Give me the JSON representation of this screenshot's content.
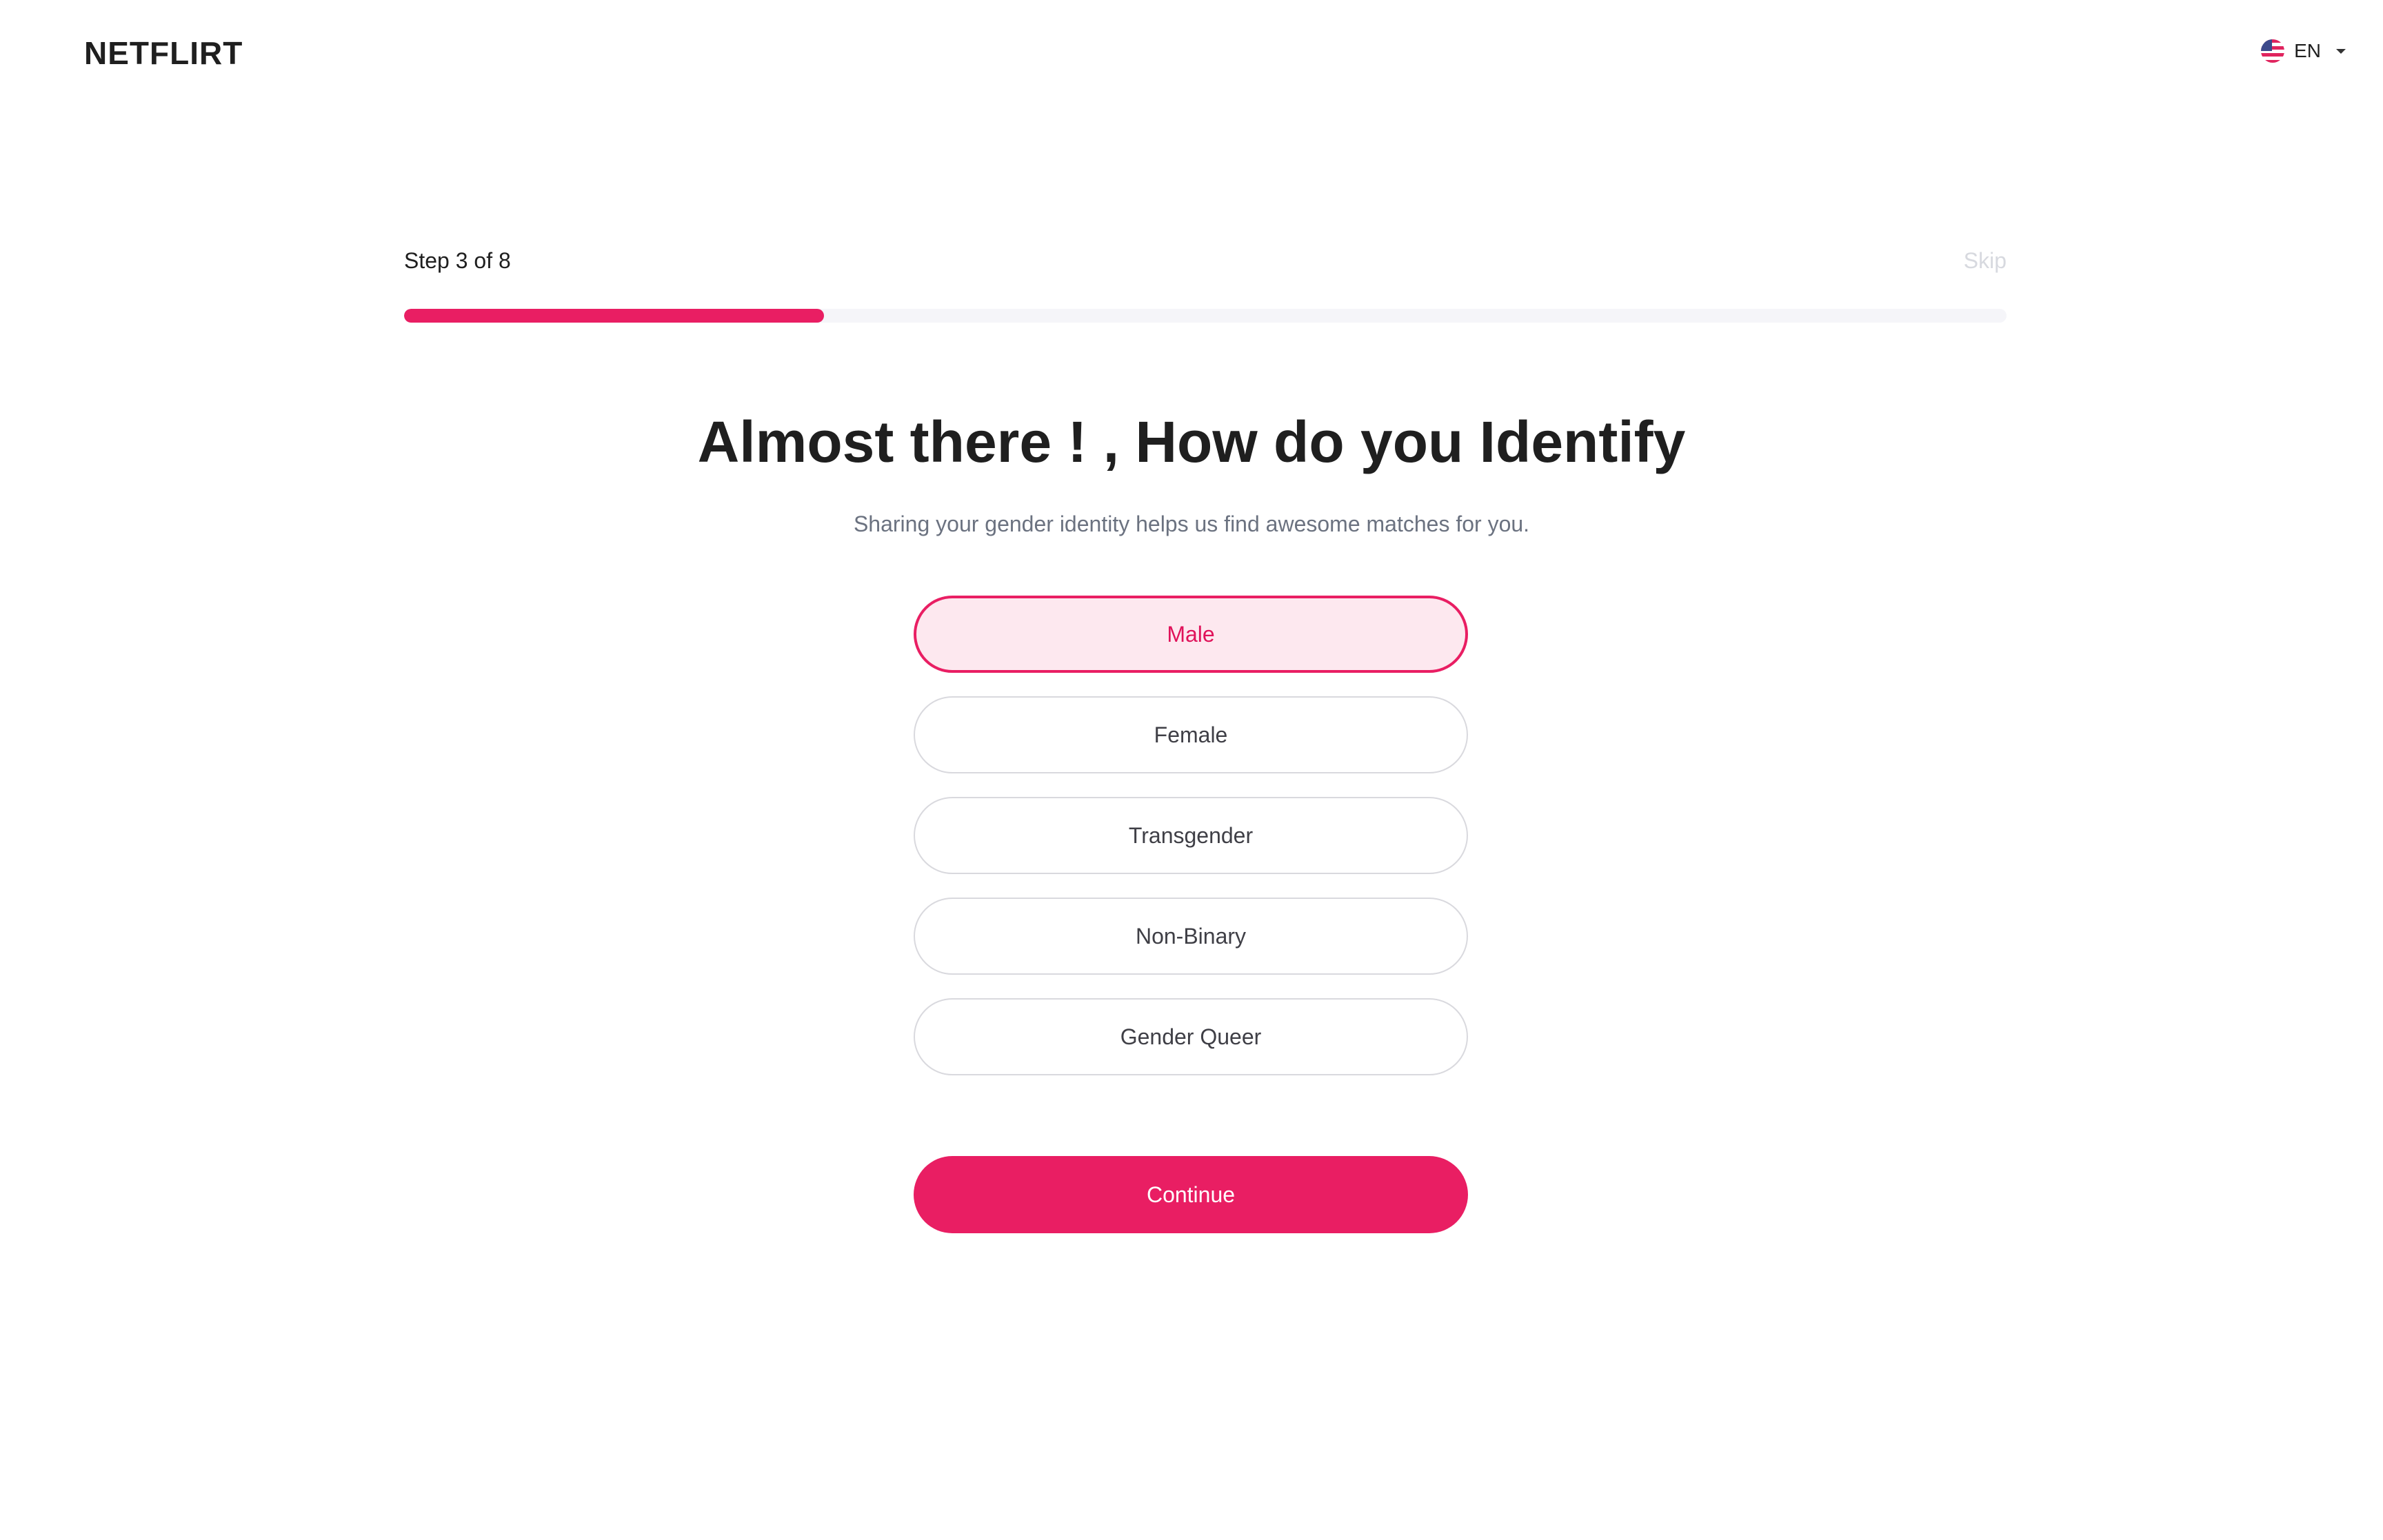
{
  "header": {
    "logo": "NETFLIRT",
    "language": {
      "code": "EN",
      "flag_icon": "us-flag-icon"
    }
  },
  "progress": {
    "step_label": "Step 3 of 8",
    "current_step": 3,
    "total_steps": 8,
    "fill_fraction": 0.262,
    "skip_label": "Skip"
  },
  "main": {
    "title": "Almost there ! , How do you Identify",
    "subtitle": "Sharing your gender identity helps us find awesome matches for you.",
    "options": [
      {
        "label": "Male",
        "selected": true
      },
      {
        "label": "Female",
        "selected": false
      },
      {
        "label": "Transgender",
        "selected": false
      },
      {
        "label": "Non-Binary",
        "selected": false
      },
      {
        "label": "Gender Queer",
        "selected": false
      }
    ],
    "continue_label": "Continue"
  },
  "colors": {
    "accent": "#e91e63",
    "selected_bg": "#fde8ef",
    "progress_track": "#f5f5f9",
    "skip_text": "#d7d9df"
  }
}
